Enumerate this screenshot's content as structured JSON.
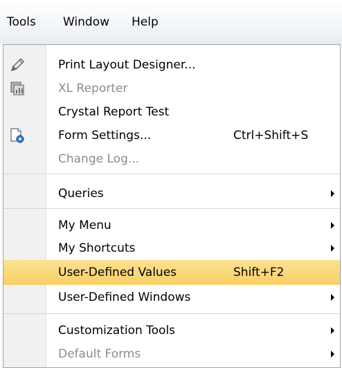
{
  "menubar": {
    "items": [
      {
        "label": "Tools"
      },
      {
        "label": "Window"
      },
      {
        "label": "Help"
      }
    ]
  },
  "menu": {
    "items": [
      {
        "label": "Print Layout Designer...",
        "icon": "pencil-icon"
      },
      {
        "label": "XL Reporter",
        "icon": "xl-reporter-icon",
        "disabled": true
      },
      {
        "label": "Crystal Report Test"
      },
      {
        "label": "Form Settings...",
        "shortcut": "Ctrl+Shift+S",
        "icon": "form-settings-icon"
      },
      {
        "label": "Change Log...",
        "disabled": true
      },
      {
        "label": "Queries",
        "submenu": true
      },
      {
        "label": "My Menu",
        "submenu": true
      },
      {
        "label": "My Shortcuts",
        "submenu": true
      },
      {
        "label": "User-Defined Values",
        "shortcut": "Shift+F2",
        "highlighted": true
      },
      {
        "label": "User-Defined Windows",
        "submenu": true
      },
      {
        "label": "Customization Tools",
        "submenu": true
      },
      {
        "label": "Default Forms",
        "submenu": true,
        "disabled": true
      }
    ]
  },
  "colors": {
    "highlight": "#fbd978",
    "disabled_text": "#8c8c8c",
    "gutter": "#f1f1f1"
  }
}
